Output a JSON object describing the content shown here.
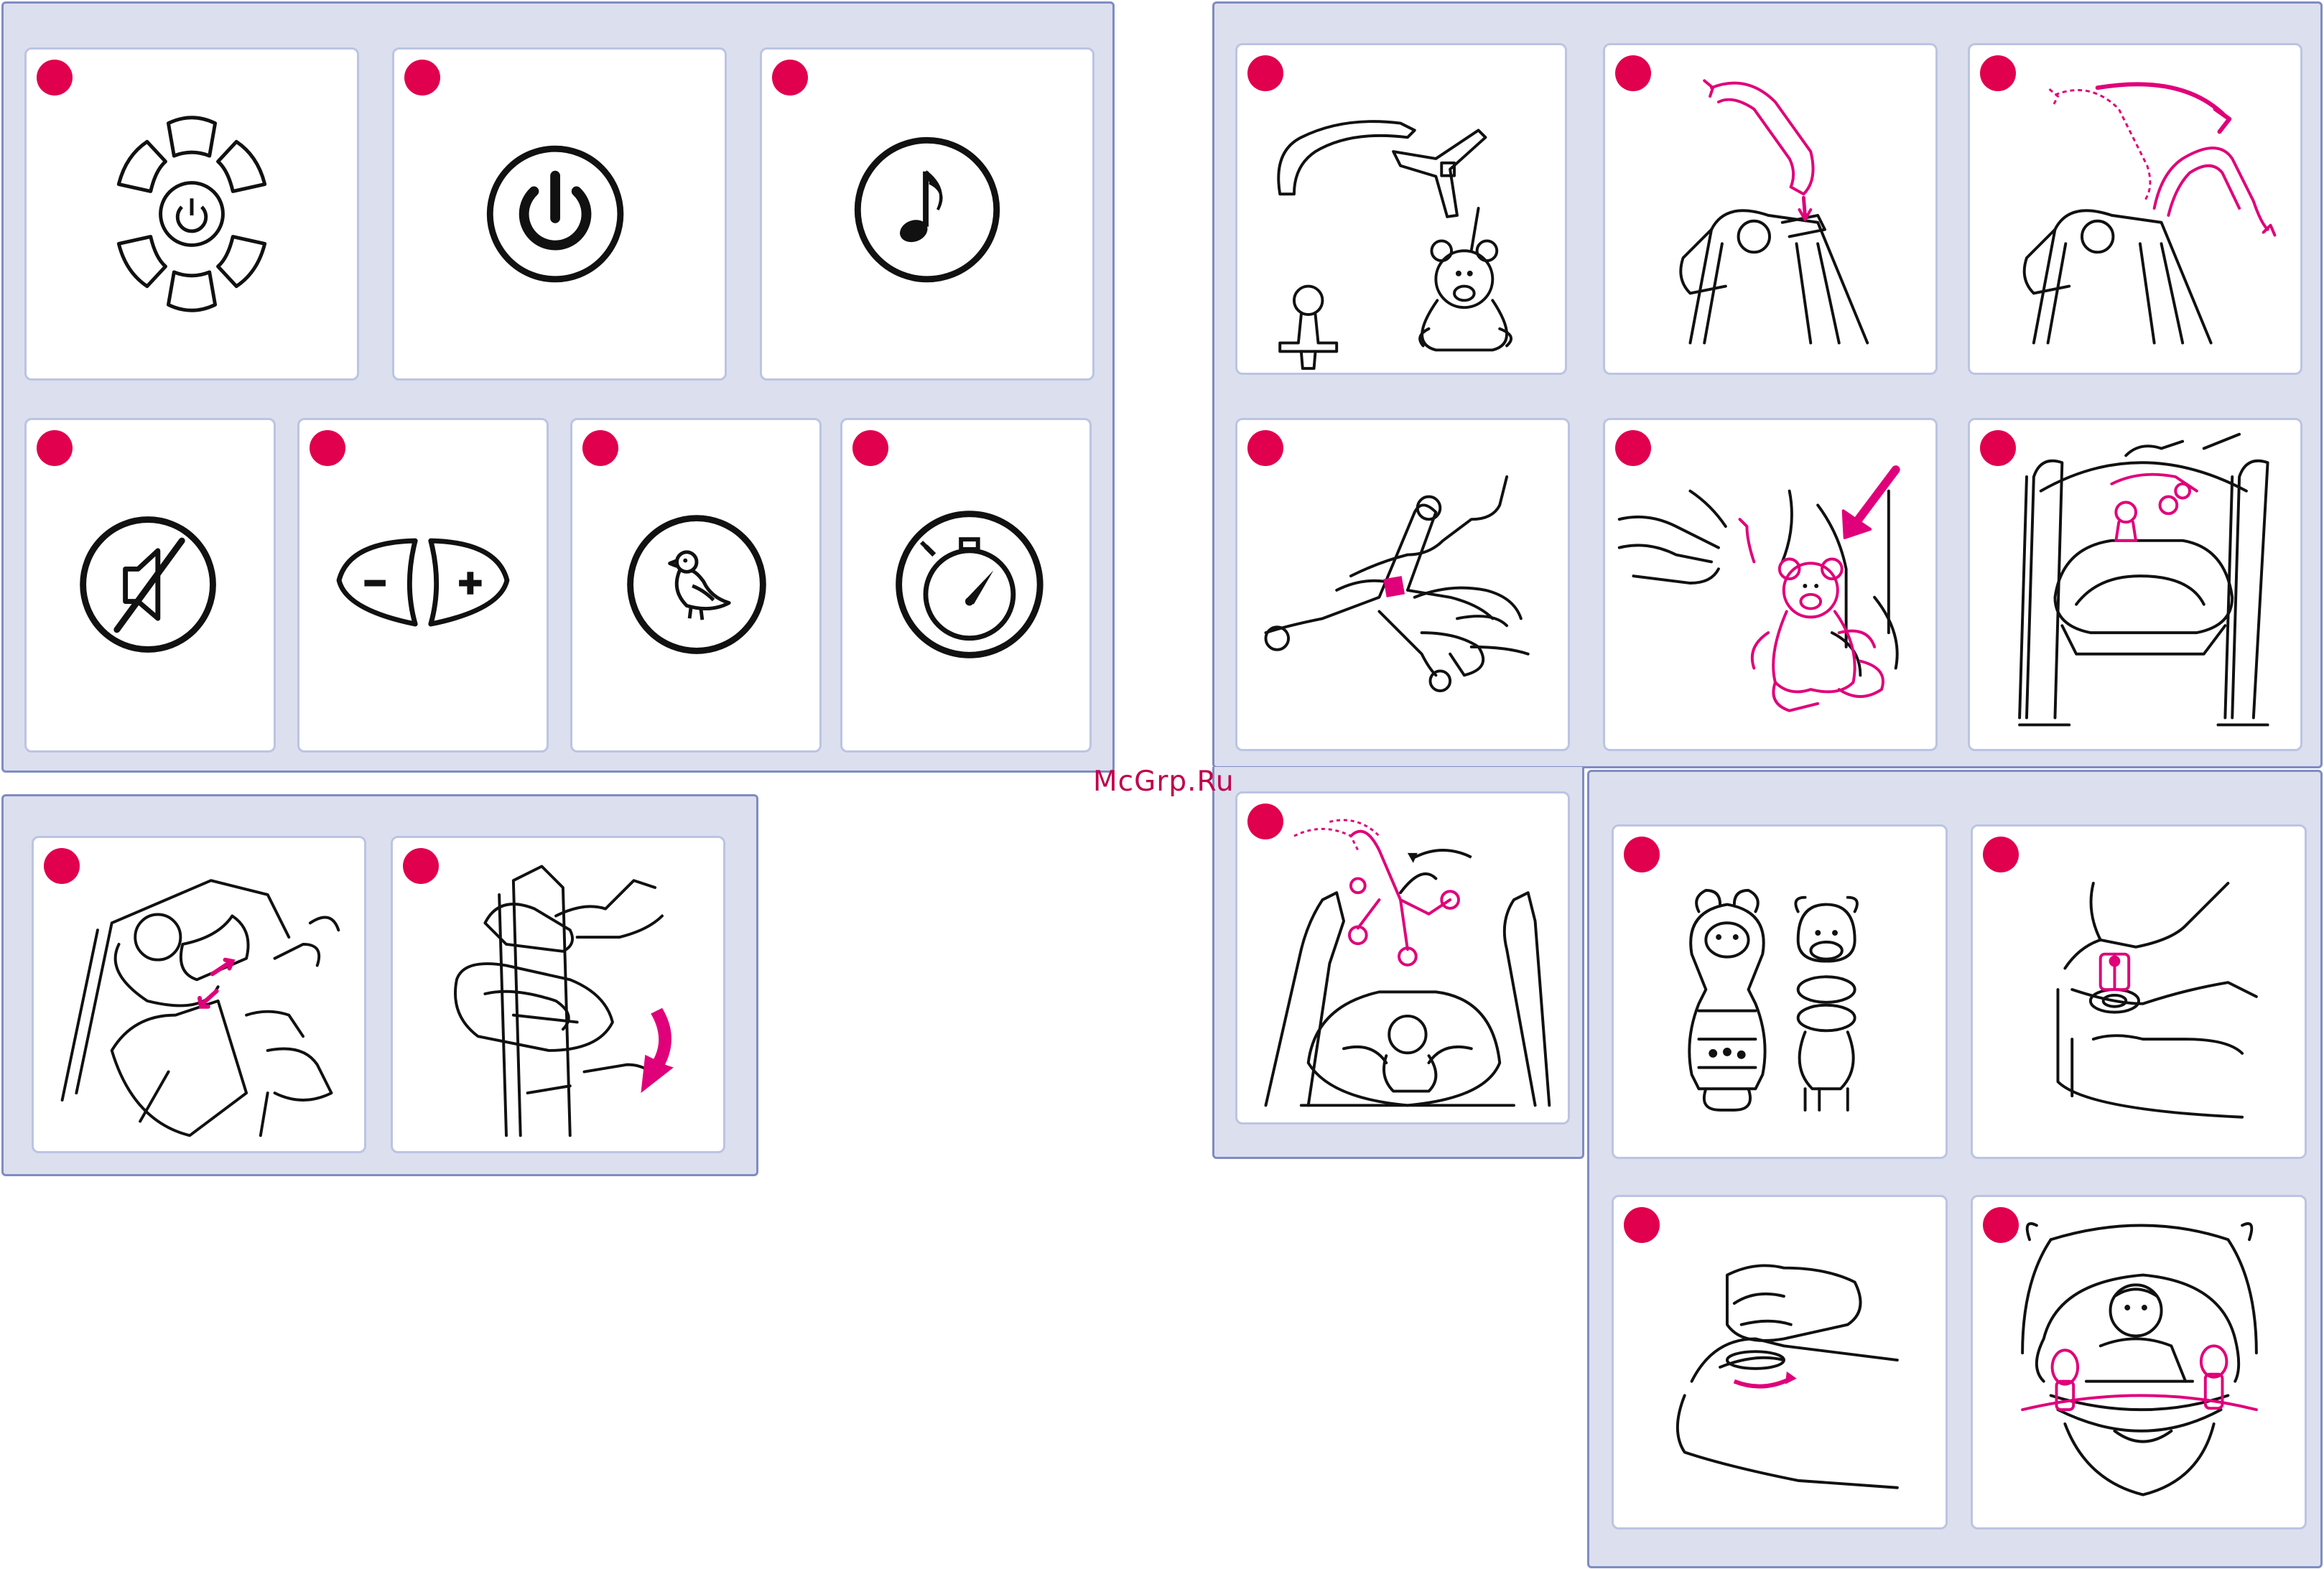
{
  "watermark": "McGrp.Ru",
  "colors": {
    "group_background": "#dcdfee",
    "group_border": "#7f8cc2",
    "step_marker": "#e0004d",
    "accent_pink": "#e0007a",
    "line_art": "#111111"
  },
  "groups": [
    {
      "name": "controls-legend",
      "panels": [
        "power-mobile-panel-icon",
        "power-icon",
        "music-note-icon",
        "mute-icon",
        "volume-minus-plus-icon",
        "bird-sounds-icon",
        "timer-stopwatch-icon"
      ]
    },
    {
      "name": "seat-recline",
      "panels": [
        "recline-adjust-illustration",
        "fold-frame-illustration"
      ]
    },
    {
      "name": "mobile-assembly",
      "panels": [
        "mobile-parts-illustration",
        "mobile-arm-insert-illustration",
        "mobile-arm-rotate-illustration",
        "mobile-hub-attach-illustration",
        "toy-attach-illustration",
        "mobile-installed-illustration",
        "mobile-in-use-illustration"
      ]
    },
    {
      "name": "tray-toys",
      "panels": [
        "tray-toys-illustration",
        "toy-press-in-illustration",
        "toy-twist-lock-illustration",
        "tray-toys-in-use-illustration"
      ]
    }
  ]
}
